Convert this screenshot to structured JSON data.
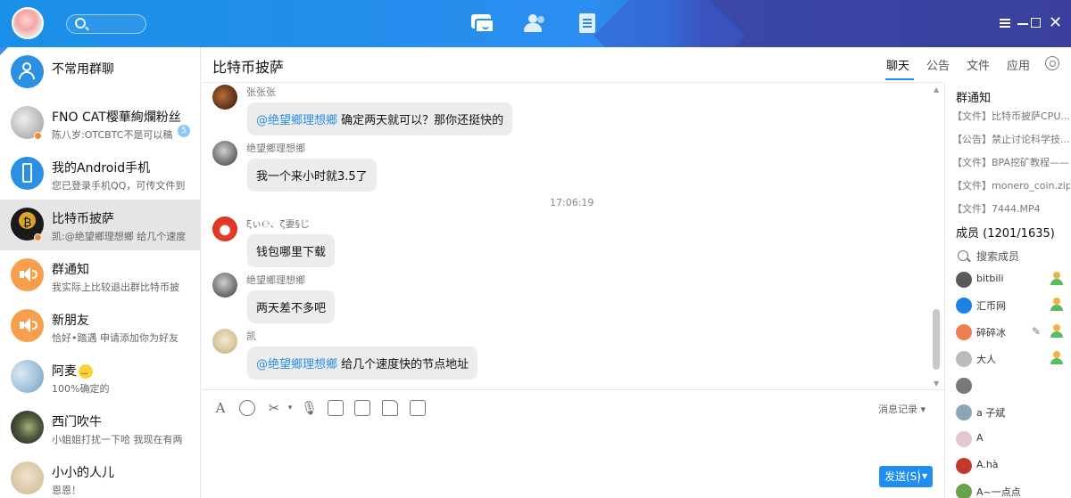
{
  "sidebar": {
    "conversations": [
      {
        "name": "不常用群聊",
        "sub": ""
      },
      {
        "name": "FNO CAT樱華絢爛粉丝",
        "sub": "陈八岁:OTCBTC不是可以稿",
        "badge": "5"
      },
      {
        "name": "我的Android手机",
        "sub": "您已登录手机QQ，可传文件到"
      },
      {
        "name": "比特币披萨",
        "sub": "凯:@绝望鄉理想鄉 给几个速度"
      },
      {
        "name": "群通知",
        "sub": "我实际上比较退出群比特币披"
      },
      {
        "name": "新朋友",
        "sub": "恰好•踏遇  申请添加你为好友"
      },
      {
        "name": "阿麦",
        "sub": "100%确定的"
      },
      {
        "name": "西门吹牛",
        "sub": "小姐姐打扰一下哈 我现在有两"
      },
      {
        "name": "小小的人儿",
        "sub": "恩恩！"
      }
    ]
  },
  "chat": {
    "title": "比特币披萨",
    "tabs": [
      "聊天",
      "公告",
      "文件",
      "应用"
    ],
    "messages": [
      {
        "sender": "张张张",
        "mention": "@绝望鄉理想鄉",
        "text": " 确定两天就可以？那你还挺快的"
      },
      {
        "sender": "绝望鄉理想鄉",
        "mention": "",
        "text": "我一个来小时就3.5了"
      },
      {
        "sender": "ξぃ℮、ζ妻§じ",
        "mention": "",
        "text": "钱包哪里下载"
      },
      {
        "sender": "绝望鄉理想鄉",
        "mention": "",
        "text": "两天差不多吧"
      },
      {
        "sender": "凯",
        "mention": "@绝望鄉理想鄉",
        "text": " 给几个速度快的节点地址"
      }
    ],
    "timestamp": "17:06:19",
    "history_label": "消息记录",
    "send_label": "发送(S)"
  },
  "right_panel": {
    "notices_title": "群通知",
    "notices": [
      "【文件】比特币披萨CPU...",
      "【公告】禁止讨论科学技...",
      "【文件】BPA挖矿教程——...",
      "【文件】monero_coin.zip",
      "【文件】7444.MP4"
    ],
    "members_title": "成员 (1201/1635)",
    "member_search": "搜索成员",
    "members": [
      {
        "name": "bitbili",
        "role": true
      },
      {
        "name": "汇币网",
        "role": true
      },
      {
        "name": "碎碎冰",
        "role": true
      },
      {
        "name": "大人",
        "role": true
      },
      {
        "name": "",
        "role": false
      },
      {
        "name": "a   子斌",
        "role": false
      },
      {
        "name": "A",
        "role": false
      },
      {
        "name": "A.hà",
        "role": false
      },
      {
        "name": "A~一点点",
        "role": false
      }
    ]
  },
  "colors": {
    "accent": "#1e8ff0",
    "mention": "#2d8fe0",
    "active_row": "#e5e5e5"
  }
}
